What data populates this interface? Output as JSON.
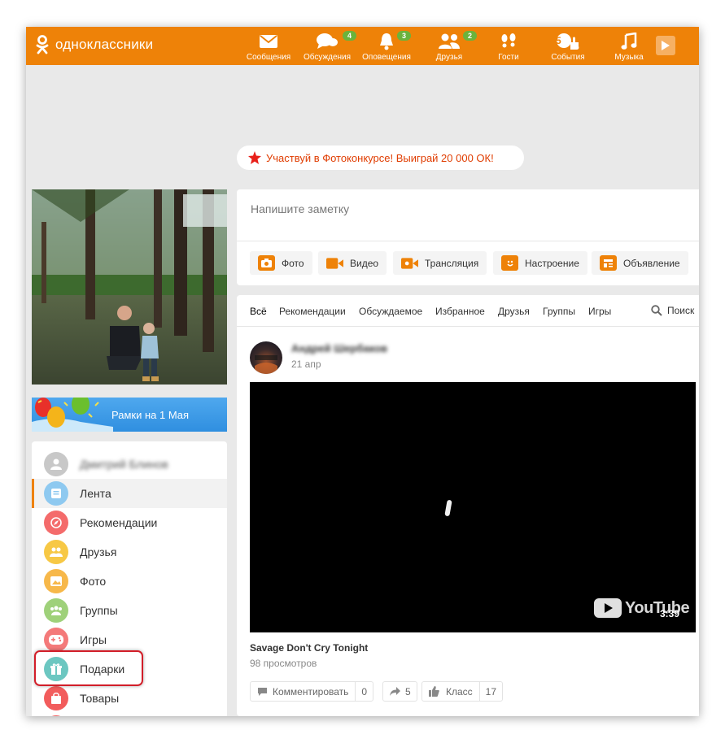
{
  "header": {
    "logo_text": "одноклассники",
    "accent_color": "#ee8208",
    "nav": [
      {
        "label": "Сообщения",
        "icon": "envelope-icon"
      },
      {
        "label": "Обсуждения",
        "icon": "chat-bubbles-icon",
        "badge": "4"
      },
      {
        "label": "Оповещения",
        "icon": "bell-icon",
        "badge": "3"
      },
      {
        "label": "Друзья",
        "icon": "friends-icon",
        "badge": "2"
      },
      {
        "label": "Гости",
        "icon": "footprints-icon"
      },
      {
        "label": "События",
        "icon": "events-thumb-icon",
        "badge": "5"
      },
      {
        "label": "Музыка",
        "icon": "music-note-icon"
      }
    ]
  },
  "promo": {
    "text": "Участвуй в Фотоконкурсе! Выиграй 20 000 ОК!"
  },
  "banner": {
    "text": "Рамки на 1 Мая"
  },
  "sidebar": {
    "user_name": "Дмитрий Блинов",
    "items": [
      {
        "label": "Лента",
        "icon": "feed-icon",
        "color": "#8ec9f0"
      },
      {
        "label": "Рекомендации",
        "icon": "compass-icon",
        "color": "#f46b6b"
      },
      {
        "label": "Друзья",
        "icon": "friends-icon",
        "color": "#f7c845"
      },
      {
        "label": "Фото",
        "icon": "photo-icon",
        "color": "#f7b84a"
      },
      {
        "label": "Группы",
        "icon": "groups-icon",
        "color": "#9fd17a"
      },
      {
        "label": "Игры",
        "icon": "gamepad-icon",
        "color": "#f47a7a"
      },
      {
        "label": "Подарки",
        "icon": "gift-icon",
        "color": "#6cc7c1"
      },
      {
        "label": "Товары",
        "icon": "bag-icon",
        "color": "#f25c5c"
      }
    ]
  },
  "composer": {
    "placeholder": "Напишите заметку",
    "buttons": [
      {
        "label": "Фото",
        "icon": "camera-icon"
      },
      {
        "label": "Видео",
        "icon": "video-camera-icon"
      },
      {
        "label": "Трансляция",
        "icon": "broadcast-icon"
      },
      {
        "label": "Настроение",
        "icon": "smiley-icon"
      },
      {
        "label": "Объявление",
        "icon": "announcement-icon"
      }
    ]
  },
  "feed": {
    "tabs": [
      "Всё",
      "Рекомендации",
      "Обсуждаемое",
      "Избранное",
      "Друзья",
      "Группы",
      "Игры"
    ],
    "search_label": "Поиск",
    "post": {
      "author": "Андрей Шербаков",
      "date": "21 апр",
      "video_brand": "YouTube",
      "duration": "3:39",
      "title": "Savage Don't Cry Tonight",
      "views": "98 просмотров",
      "actions": {
        "comment_label": "Комментировать",
        "comment_count": "0",
        "share_count": "5",
        "like_label": "Класс",
        "like_count": "17"
      }
    }
  }
}
